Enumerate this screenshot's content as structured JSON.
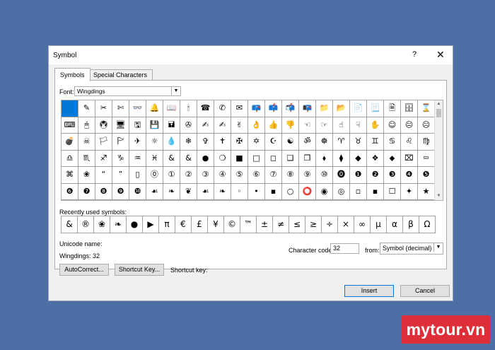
{
  "dialog": {
    "title": "Symbol",
    "help": "?",
    "close": "✕"
  },
  "tabs": [
    "Symbols",
    "Special Characters"
  ],
  "font": {
    "label": "Font:",
    "value": "Wingdings"
  },
  "grid": [
    " ",
    "✎",
    "✂",
    "✄",
    "👓",
    "🔔",
    "📖",
    "🕯",
    "☎",
    "✆",
    "✉",
    "📪",
    "📫",
    "📬",
    "📭",
    "📁",
    "📂",
    "📄",
    "📃",
    "🗎",
    "🗄",
    "⌛",
    "⌨",
    "🖱",
    "🖲",
    "🖥",
    "🖫",
    "💾",
    "🖬",
    "✇",
    "✍",
    "✍",
    "✌",
    "👌",
    "👍",
    "👎",
    "☜",
    "☞",
    "☝",
    "☟",
    "✋",
    "☺",
    "😐",
    "☹",
    "💣",
    "☠",
    "🏳",
    "🏱",
    "✈",
    "☼",
    "💧",
    "❄",
    "✞",
    "✝",
    "✠",
    "✡",
    "☪",
    "☯",
    "ॐ",
    "☸",
    "♈",
    "♉",
    "♊",
    "♋",
    "♌",
    "♍",
    "♎",
    "♏",
    "♐",
    "♑",
    "♒",
    "♓",
    "&",
    "&",
    "●",
    "❍",
    "■",
    "□",
    "◻",
    "❑",
    "❒",
    "⬧",
    "⧫",
    "◆",
    "❖",
    "⬥",
    "⌧",
    "⮹",
    "⌘",
    "❀",
    "“",
    "”",
    "▯",
    "⓪",
    "①",
    "②",
    "③",
    "④",
    "⑤",
    "⑥",
    "⑦",
    "⑧",
    "⑨",
    "⑩",
    "⓿",
    "❶",
    "❷",
    "❸",
    "❹",
    "❺",
    "❻",
    "❼",
    "❽",
    "❾",
    "❿",
    "☙",
    "❧",
    "❦",
    "☙",
    "❧",
    "◦",
    "•",
    "▪",
    "○",
    "⭕",
    "◉",
    "◎",
    "▫",
    "▪",
    "☐",
    "✦",
    "★",
    "✶"
  ],
  "recent": {
    "label": "Recently used symbols:",
    "symbols": [
      "&",
      "®",
      "❀",
      "❧",
      "●",
      "▶",
      "π",
      "€",
      "£",
      "¥",
      "©",
      "™",
      "±",
      "≠",
      "≤",
      "≥",
      "÷",
      "×",
      "∞",
      "µ",
      "α",
      "β",
      "Ω"
    ]
  },
  "unicode": {
    "label": "Unicode name:",
    "value": "Wingdings: 32"
  },
  "char_code": {
    "label": "Character code:",
    "value": "32"
  },
  "from": {
    "label": "from:",
    "value": "Symbol (decimal)"
  },
  "buttons": {
    "autocorrect": "AutoCorrect...",
    "shortcut_key": "Shortcut Key...",
    "insert": "Insert",
    "cancel": "Cancel"
  },
  "shortcut_label": "Shortcut key:",
  "brand": "mytour.vn",
  "colors": {
    "desktop": "#4d6fa6",
    "selection": "#0078d7",
    "brand": "#dd2e39"
  }
}
